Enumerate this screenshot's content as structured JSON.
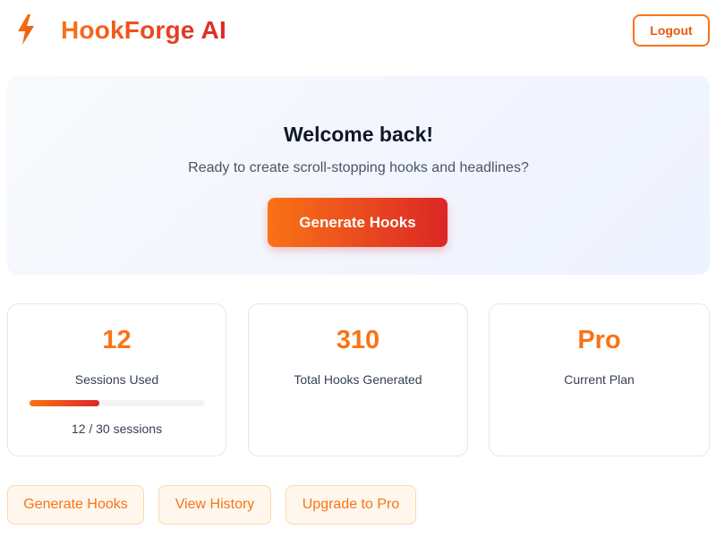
{
  "header": {
    "logo_icon": "lightning-bolt-icon",
    "app_name": "HookForge AI",
    "logout_label": "Logout"
  },
  "hero": {
    "title": "Welcome back!",
    "subtitle": "Ready to create scroll-stopping hooks and headlines?",
    "cta_label": "Generate Hooks"
  },
  "stats": [
    {
      "value": "12",
      "label": "Sessions Used",
      "progress_fraction": 0.4,
      "progress_text": "12 / 30 sessions"
    },
    {
      "value": "310",
      "label": "Total Hooks Generated"
    },
    {
      "value": "Pro",
      "label": "Current Plan"
    }
  ],
  "actions": [
    {
      "label": "Generate Hooks"
    },
    {
      "label": "View History"
    },
    {
      "label": "Upgrade to Pro"
    }
  ],
  "colors": {
    "accent_orange": "#f97316",
    "accent_red": "#dc2626",
    "hero_background": "#f1f5fe",
    "action_background": "#fff7ed"
  }
}
